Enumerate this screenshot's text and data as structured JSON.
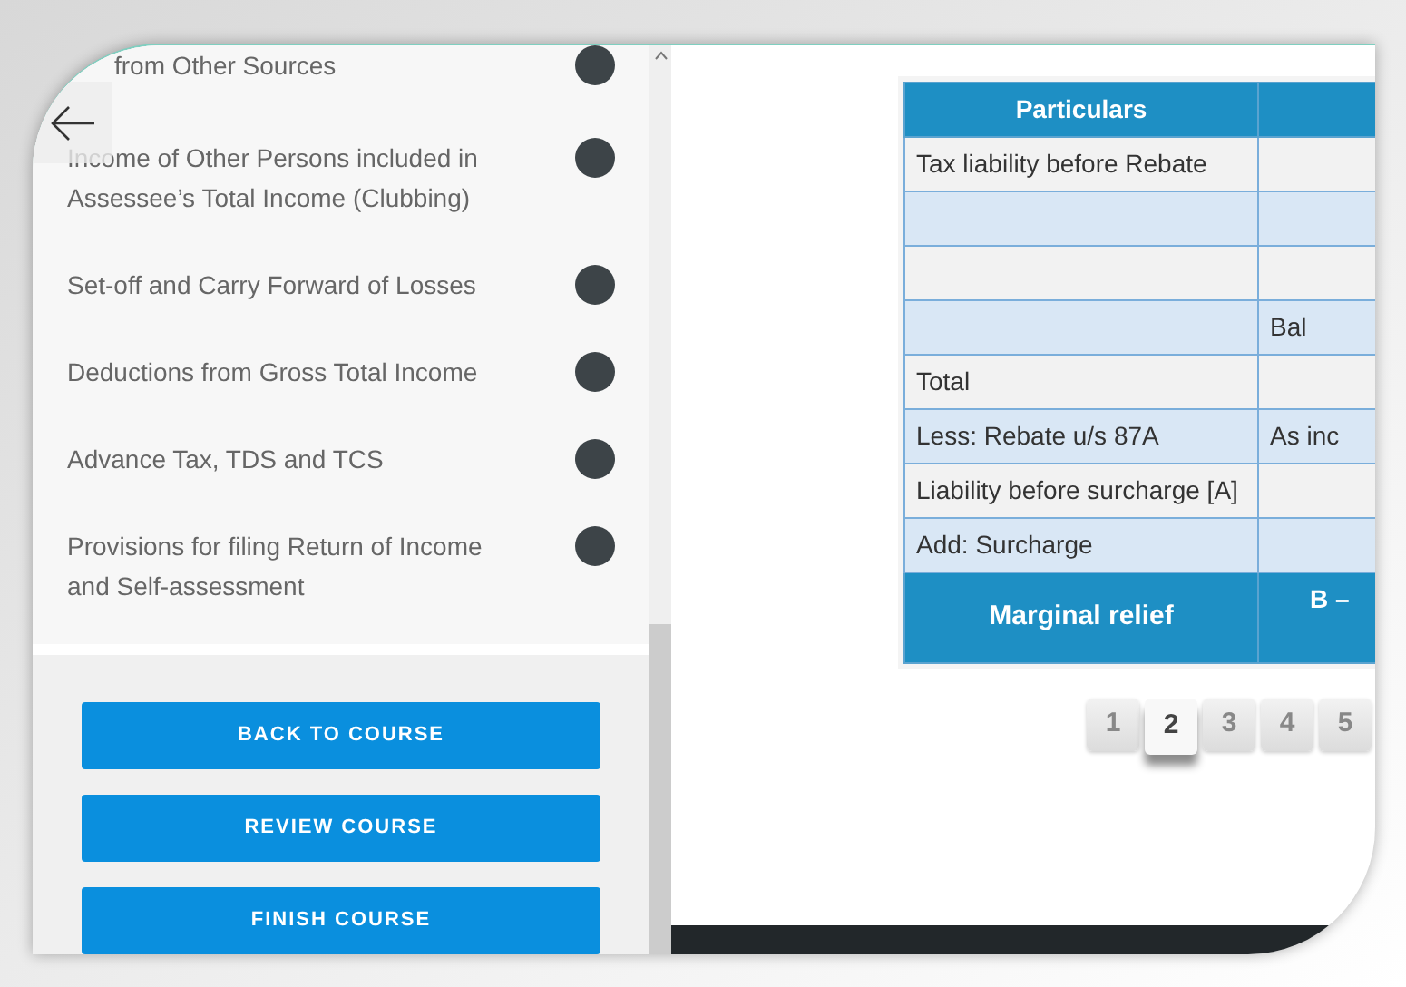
{
  "sidebar": {
    "items": [
      {
        "label": "from Other Sources",
        "completed": true
      },
      {
        "label": "Income of Other Persons included in Assessee’s Total Income (Clubbing)",
        "completed": true
      },
      {
        "label": "Set-off and Carry Forward of Losses",
        "completed": true
      },
      {
        "label": "Deductions from Gross Total Income",
        "completed": true
      },
      {
        "label": "Advance Tax, TDS and TCS",
        "completed": true
      },
      {
        "label": "Provisions for filing Return of Income and Self-assessment",
        "completed": true
      }
    ],
    "buttons": [
      "BACK TO COURSE",
      "REVIEW COURSE",
      "FINISH COURSE"
    ]
  },
  "table": {
    "columns": [
      "Particulars",
      ""
    ],
    "rows": [
      {
        "cells": [
          "Tax liability before Rebate",
          ""
        ]
      },
      {
        "cells": [
          "",
          ""
        ]
      },
      {
        "cells": [
          "",
          ""
        ]
      },
      {
        "cells": [
          "",
          "Bal"
        ]
      },
      {
        "cells": [
          "Total",
          ""
        ]
      },
      {
        "cells": [
          "Less: Rebate u/s 87A",
          "As inc"
        ]
      },
      {
        "cells": [
          "Liability before surcharge [A]",
          ""
        ]
      },
      {
        "cells": [
          "Add: Surcharge",
          ""
        ]
      }
    ],
    "footer": [
      "Marginal relief",
      "B –"
    ]
  },
  "pagination": [
    {
      "label": "1",
      "selected": false
    },
    {
      "label": "2",
      "selected": true
    },
    {
      "label": "3",
      "selected": false
    },
    {
      "label": "4",
      "selected": false
    },
    {
      "label": "5",
      "selected": false
    }
  ]
}
